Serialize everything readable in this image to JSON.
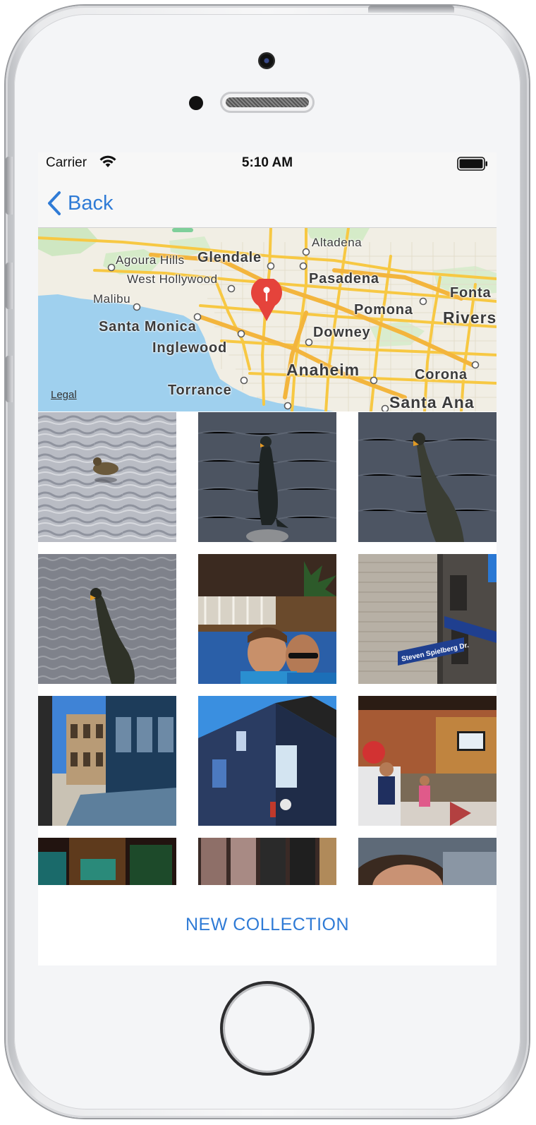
{
  "status_bar": {
    "carrier": "Carrier",
    "time": "5:10 AM",
    "wifi_icon": "wifi-icon",
    "battery_icon": "battery-icon"
  },
  "nav": {
    "back_label": "Back",
    "back_icon": "chevron-left-icon",
    "accent": "#2f7bd6"
  },
  "map": {
    "places": [
      "Altadena",
      "Agoura Hills",
      "Glendale",
      "Pasadena",
      "West Hollywood",
      "Malibu",
      "Fonta",
      "Pomona",
      "Rivers",
      "Santa Monica",
      "Downey",
      "Inglewood",
      "Anaheim",
      "Corona",
      "Torrance",
      "Santa Ana"
    ],
    "legal": "Legal",
    "pin_icon": "map-pin-icon",
    "pin_color": "#e5433b"
  },
  "photos": [
    {
      "subject": "duck on water"
    },
    {
      "subject": "cormorant on rock"
    },
    {
      "subject": "cormorant standing in water"
    },
    {
      "subject": "cormorant in water"
    },
    {
      "subject": "selfie on ride"
    },
    {
      "subject": "Steven Spielberg Dr. street sign",
      "caption": "Steven Spielberg Dr."
    },
    {
      "subject": "backlot street buildings"
    },
    {
      "subject": "studio building"
    },
    {
      "subject": "restaurant interior"
    },
    {
      "subject": "shop display"
    },
    {
      "subject": "chocolate bars"
    },
    {
      "subject": "portrait"
    }
  ],
  "footer": {
    "new_collection_label": "NEW COLLECTION"
  }
}
